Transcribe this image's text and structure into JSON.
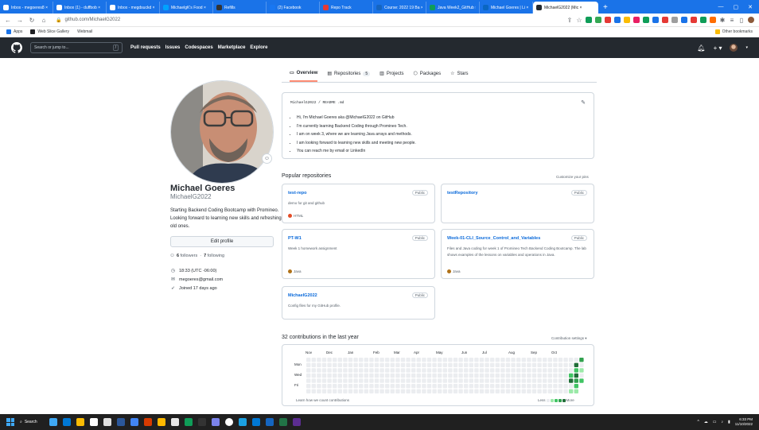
{
  "browser": {
    "tabs": [
      {
        "title": "Inbox - megoeres8 ×",
        "color": "#ffffff"
      },
      {
        "title": "Inbox (1) - duffbob ×",
        "color": "#ffffff"
      },
      {
        "title": "Inbox - megdsuckd ×",
        "color": "#ffffff"
      },
      {
        "title": "MichaelgK's Food ×",
        "color": "#00a2ff"
      },
      {
        "title": "Refills",
        "color": "#333333"
      },
      {
        "title": "(2) Facebook",
        "color": "#1877f2"
      },
      {
        "title": "Repo Track",
        "color": "#e53935"
      },
      {
        "title": "Course: 2022 19 Ba ×",
        "color": "#1565c0"
      },
      {
        "title": "Java Week2_GitHub ×",
        "color": "#0f9d58"
      },
      {
        "title": "Michael Goeres | Li ×",
        "color": "#0a66c2"
      },
      {
        "title": "MichaelG2022 (Mic ×",
        "color": "#24292f",
        "active": true
      }
    ],
    "new_tab": "+",
    "url": "github.com/MichaelG2022",
    "bookmarks": [
      "Apps",
      "Web Slice Gallery",
      "Webmail"
    ],
    "other_bookmarks": "Other bookmarks"
  },
  "github": {
    "search_placeholder": "Search or jump to...",
    "search_key": "/",
    "nav": [
      "Pull requests",
      "Issues",
      "Codespaces",
      "Marketplace",
      "Explore"
    ],
    "plus_label": "+ ▾"
  },
  "profile": {
    "name": "Michael Goeres",
    "login": "MichaelG2022",
    "bio": "Starting Backend Coding Bootcamp with Promineo. Looking forward to learning new skills and refreshing old ones.",
    "edit_button": "Edit profile",
    "followers_count": "6",
    "followers_label": "followers",
    "following_count": "7",
    "following_label": "following",
    "time": "18:33 (UTC -06:00)",
    "email": "megoeres@gmail.com",
    "joined": "Joined 17 days ago"
  },
  "tabs": [
    {
      "label": "Overview",
      "icon": "book-icon",
      "selected": true
    },
    {
      "label": "Repositories",
      "icon": "repo-icon",
      "count": "5"
    },
    {
      "label": "Projects",
      "icon": "project-icon"
    },
    {
      "label": "Packages",
      "icon": "package-icon"
    },
    {
      "label": "Stars",
      "icon": "star-icon"
    }
  ],
  "readme": {
    "path": "MichaelG2022 / README .md",
    "items": [
      "Hi, I'm Michael Goeres aka @MichaelG2022 on GitHub",
      "I'm currently learning Backend Coding through Promineo Tech.",
      "I am on week 3, where we are learning Java arrays and methods.",
      "I am looking forward to learning new skills and meeting new people.",
      "You can reach me by email or LinkedIn"
    ]
  },
  "popular": {
    "heading": "Popular repositories",
    "customize": "Customize your pins",
    "repos": [
      {
        "name": "test-repo",
        "badge": "Public",
        "desc": "demo for git and github",
        "lang": "HTML",
        "lang_color": "#e34c26"
      },
      {
        "name": "testRepository",
        "badge": "Public",
        "desc": "",
        "lang": "",
        "lang_color": ""
      },
      {
        "name": "PT-W1",
        "badge": "Public",
        "desc": "Week 1 homework assignment",
        "lang": "Java",
        "lang_color": "#b07219"
      },
      {
        "name": "Week-01-CLI_Source_Control_and_Variables",
        "badge": "Public",
        "desc": "Files and Java coding for week 1 of Promineo Tech Backend Coding Bootcamp. The lab shows examples of the lessons on variables and operations in Java.",
        "lang": "Java",
        "lang_color": "#b07219"
      },
      {
        "name": "MichaelG2022",
        "badge": "Public",
        "desc": "Config files for my GitHub profile.",
        "lang": "",
        "lang_color": ""
      }
    ]
  },
  "contributions": {
    "heading": "32 contributions in the last year",
    "settings": "Contribution settings ▾",
    "months": [
      "Nov",
      "Dec",
      "Jan",
      "Feb",
      "Mar",
      "Apr",
      "May",
      "Jun",
      "Jul",
      "Aug",
      "Sep",
      "Oct"
    ],
    "days": [
      "Mon",
      "Wed",
      "Fri"
    ],
    "learn": "Learn how we count contributions",
    "less": "Less",
    "more": "More",
    "levels": [
      "#ebedf0",
      "#9be9a8",
      "#40c463",
      "#30a14e",
      "#216e39"
    ]
  },
  "taskbar": {
    "search": "Search",
    "time": "6:33 PM",
    "date": "11/10/2022"
  }
}
